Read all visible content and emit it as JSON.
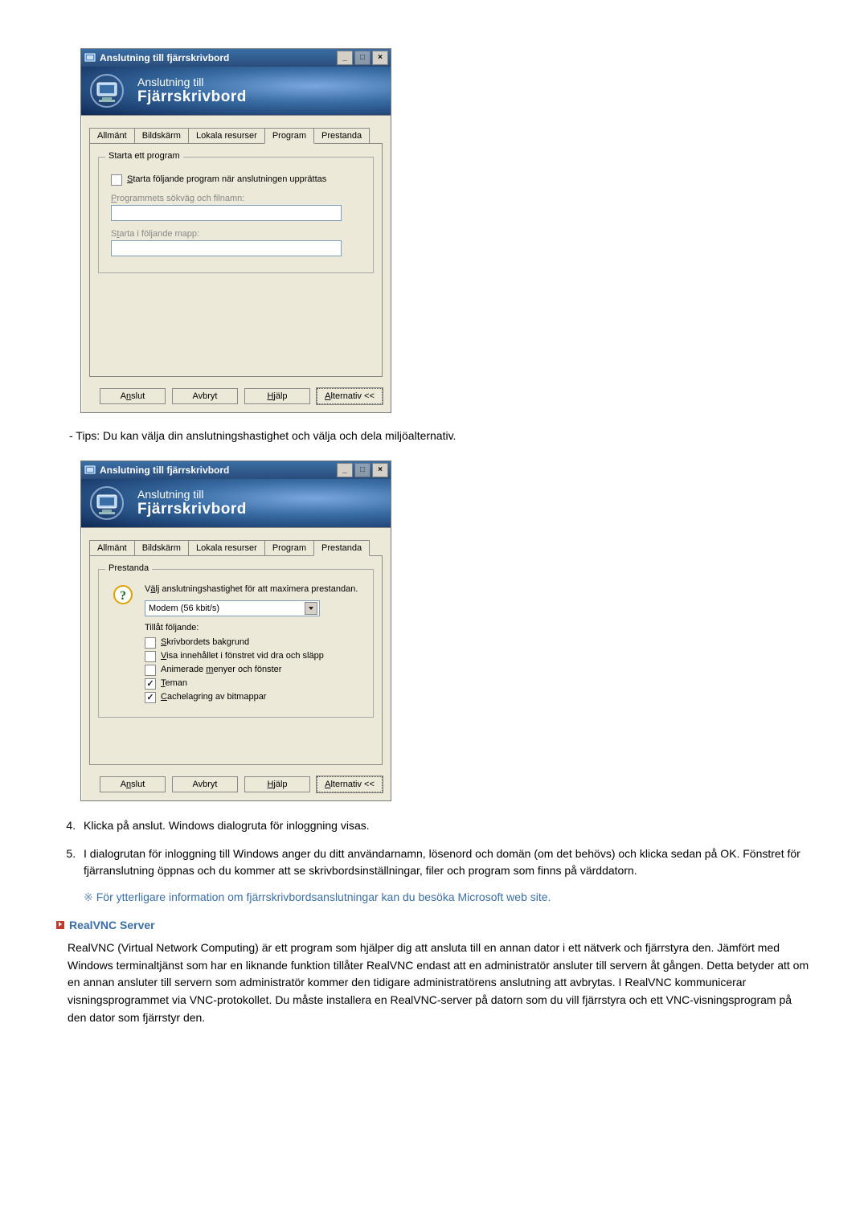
{
  "dialog1": {
    "title": "Anslutning till fjärrskrivbord",
    "banner_line1": "Anslutning till",
    "banner_line2": "Fjärrskrivbord",
    "tabs": [
      "Allmänt",
      "Bildskärm",
      "Lokala resurser",
      "Program",
      "Prestanda"
    ],
    "active_tab": 3,
    "group_title": "Starta ett program",
    "checkbox_label": "Starta följande program när anslutningen upprättas",
    "field1_label": "Programmets sökväg och filnamn:",
    "field2_label": "Starta i följande mapp:",
    "buttons": {
      "connect": "Anslut",
      "cancel": "Avbryt",
      "help": "Hjälp",
      "options": "Alternativ <<"
    }
  },
  "tip_line": "- Tips: Du kan välja din anslutningshastighet och välja och dela miljöalternativ.",
  "dialog2": {
    "title": "Anslutning till fjärrskrivbord",
    "banner_line1": "Anslutning till",
    "banner_line2": "Fjärrskrivbord",
    "tabs": [
      "Allmänt",
      "Bildskärm",
      "Lokala resurser",
      "Program",
      "Prestanda"
    ],
    "active_tab": 4,
    "group_title": "Prestanda",
    "perf_hint": "Välj anslutningshastighet för att maximera prestandan.",
    "select_value": "Modem (56 kbit/s)",
    "allow_label": "Tillåt följande:",
    "checks": [
      {
        "label": "Skrivbordets bakgrund",
        "checked": false
      },
      {
        "label": "Visa innehållet i fönstret vid dra och släpp",
        "checked": false
      },
      {
        "label": "Animerade menyer och fönster",
        "checked": false
      },
      {
        "label": "Teman",
        "checked": true
      },
      {
        "label": "Cachelagring av bitmappar",
        "checked": true
      }
    ],
    "buttons": {
      "connect": "Anslut",
      "cancel": "Avbryt",
      "help": "Hjälp",
      "options": "Alternativ <<"
    }
  },
  "steps": {
    "s4": "Klicka på anslut. Windows dialogruta för inloggning visas.",
    "s5": "I dialogrutan för inloggning till Windows anger du ditt användarnamn, lösenord och domän (om det behövs) och klicka sedan på OK. Fönstret för fjärranslutning öppnas och du kommer att se skrivbordsinställningar, filer och program som finns på värddatorn."
  },
  "notice_text": "För ytterligare information om fjärrskrivbordsanslutningar kan du besöka Microsoft web site.",
  "section_header": "RealVNC Server",
  "paragraph": "RealVNC (Virtual Network Computing) är ett program som hjälper dig att ansluta till en annan dator i ett nätverk och fjärrstyra den. Jämfört med Windows terminaltjänst som har en liknande funktion tillåter RealVNC endast att en administratör ansluter till servern åt gången. Detta betyder att om en annan ansluter till servern som administratör kommer den tidigare administratörens anslutning att avbrytas. I RealVNC kommunicerar visningsprogrammet via VNC-protokollet. Du måste installera en RealVNC-server på datorn som du vill fjärrstyra och ett VNC-visningsprogram på den dator som fjärrstyr den."
}
